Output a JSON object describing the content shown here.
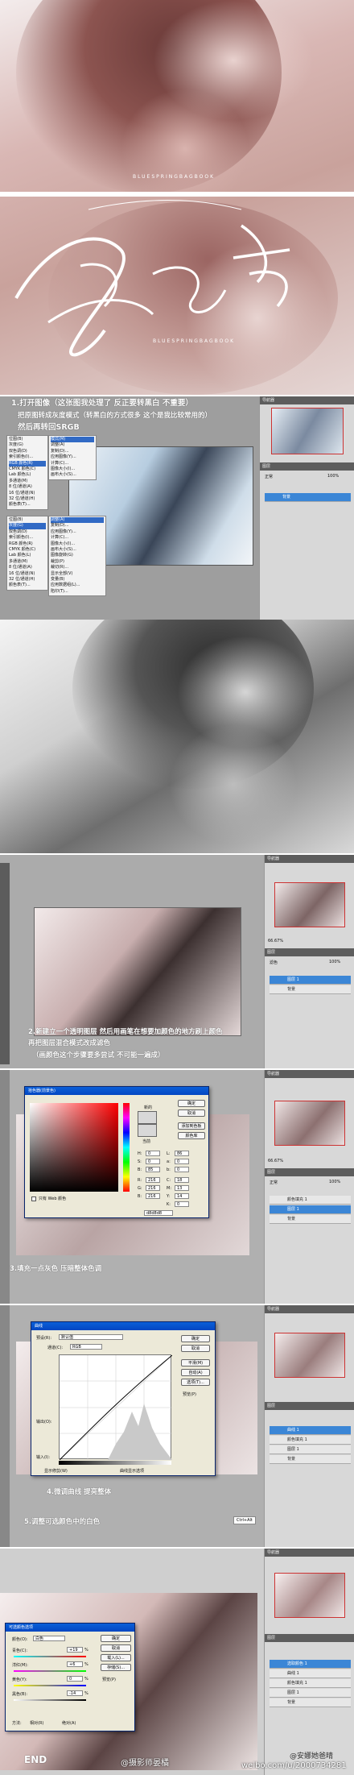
{
  "banner": {
    "watermark1": "BLUESPRINGBAGBOOK",
    "watermark2": "BLUESPRINGBAGBOOK",
    "signature": "春和景"
  },
  "steps": {
    "s1_line1": "1.打开图像（这张图我处理了 反正要转黑白 不重要）",
    "s1_line2": "把原图转成灰度模式（转黑白的方式很多 这个是我比较常用的）",
    "s1_line3": "然后再转回SRGB",
    "s2_line1": "2.新建立一个透明图层 然后用画笔在想要加颜色的地方刷上颜色",
    "s2_line2": "再把图层混合模式改成滤色",
    "s2_line3": "（画颜色这个步骤要多尝试 不可能一遍成）",
    "s3": "3.填充一点灰色 压暗整体色调",
    "s4": "4.微调曲线 提亮整体",
    "s5": "5.调整可选颜色中的白色",
    "s5_hint": "Ctrl+Alt",
    "end": "END"
  },
  "menu1": [
    "位图(B)",
    "灰度(G)",
    "双色调(D)",
    "索引颜色(I)...",
    "RGB 颜色(R)",
    "CMYK 颜色(C)",
    "Lab 颜色(L)",
    "多通道(M)",
    "8 位/通道(A)",
    "16 位/通道(N)",
    "32 位/通道(H)",
    "颜色表(T)..."
  ],
  "menu1_top": "模式(M)",
  "menu2": [
    "调整(A)",
    "复制(D)...",
    "应用图像(Y)...",
    "计算(C)...",
    "图像大小(I)...",
    "画布大小(S)...",
    "图像旋转(G)",
    "裁剪(P)",
    "裁切(R)...",
    "显示全部(V)",
    "变量(B)",
    "应用数据组(L)...",
    "陷印(T)..."
  ],
  "menu2_shortcuts": [
    "Alt+Ctrl+I",
    "Alt+Ctrl+C"
  ],
  "panels": {
    "nav": "导航器",
    "hist": "直方图",
    "info": "信息",
    "layers": "图层",
    "channels": "通道",
    "paths": "路径",
    "mode": "正常",
    "opacity_label": "不透明度:",
    "opacity": "100%",
    "fill_label": "填充:",
    "fill": "100%",
    "screen": "滤色",
    "zoom": "66.67%",
    "layer_bg": "背景",
    "layer1": "图层 1",
    "fill_layer": "颜色填充 1",
    "curves_layer": "曲线 1",
    "selcolor_layer": "选取颜色 1"
  },
  "color_picker": {
    "title": "拾色器(前景色)",
    "ok": "确定",
    "cancel": "取消",
    "add_swatch": "添加到色板",
    "libraries": "颜色库",
    "new_label": "新的",
    "current_label": "当前",
    "only_web": "只有 Web 颜色",
    "h": "H:",
    "hv": "0",
    "s": "S:",
    "sv": "0",
    "b": "B:",
    "bv": "85",
    "r": "R:",
    "rv": "216",
    "g": "G:",
    "gv": "216",
    "bb": "B:",
    "bbv": "216",
    "l": "L:",
    "lv": "86",
    "a": "a:",
    "av": "0",
    "b2": "b:",
    "b2v": "0",
    "c": "C:",
    "cv": "18",
    "m": "M:",
    "mv": "13",
    "y": "Y:",
    "yv": "14",
    "k": "K:",
    "kv": "0",
    "hex": "d8d8d8"
  },
  "curves": {
    "title": "曲线",
    "preset_label": "预设(R):",
    "preset": "默认值",
    "channel_label": "通道(C):",
    "channel": "RGB",
    "ok": "确定",
    "cancel": "取消",
    "smooth": "平滑(M)",
    "auto": "自动(A)",
    "options": "选项(T)...",
    "preview": "预览(P)",
    "output": "输出(O):",
    "input": "输入(I):",
    "show_clip": "显示修剪(W)",
    "curve_options": "曲线显示选项"
  },
  "selective": {
    "title": "可选颜色选项",
    "colors_label": "颜色(O):",
    "colors": "白色",
    "cyan": "青色(C):",
    "cyan_v": "+19",
    "magenta": "洋红(M):",
    "magenta_v": "+6",
    "yellow": "黄色(Y):",
    "yellow_v": "0",
    "black": "黑色(B):",
    "black_v": "-14",
    "pct": "%",
    "ok": "确定",
    "cancel": "取消",
    "load": "载入(L)...",
    "save": "存储(S)...",
    "preview": "预览(P)",
    "method": "方法:",
    "relative": "相对(R)",
    "absolute": "绝对(A)"
  },
  "footer": {
    "left_wm": "@摄影师晏橘",
    "right_wm": "@安娜她爸晴",
    "url": "weibo.com/u/2000734281"
  },
  "colors": {
    "ps_dark": "#5c5c5c",
    "panel": "#d8d8d8",
    "accent": "#3b86d6",
    "xp_title": "#0a5fd8"
  }
}
